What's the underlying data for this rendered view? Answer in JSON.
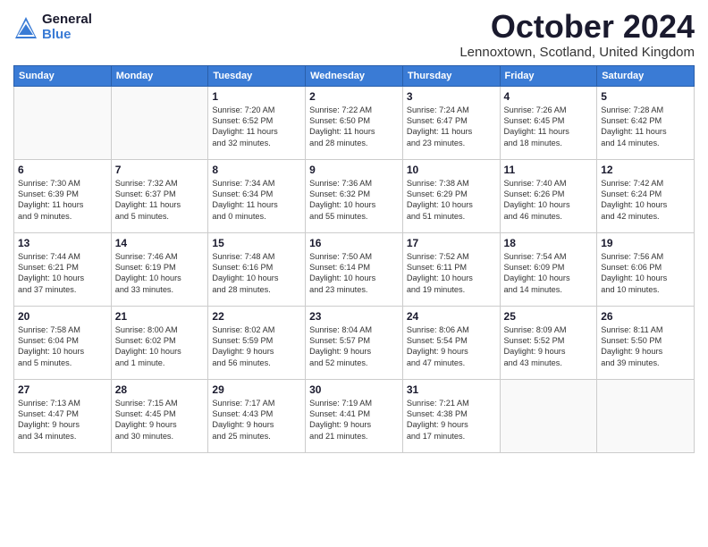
{
  "header": {
    "logo_general": "General",
    "logo_blue": "Blue",
    "month": "October 2024",
    "location": "Lennoxtown, Scotland, United Kingdom"
  },
  "days_of_week": [
    "Sunday",
    "Monday",
    "Tuesday",
    "Wednesday",
    "Thursday",
    "Friday",
    "Saturday"
  ],
  "weeks": [
    [
      {
        "day": "",
        "detail": ""
      },
      {
        "day": "",
        "detail": ""
      },
      {
        "day": "1",
        "detail": "Sunrise: 7:20 AM\nSunset: 6:52 PM\nDaylight: 11 hours\nand 32 minutes."
      },
      {
        "day": "2",
        "detail": "Sunrise: 7:22 AM\nSunset: 6:50 PM\nDaylight: 11 hours\nand 28 minutes."
      },
      {
        "day": "3",
        "detail": "Sunrise: 7:24 AM\nSunset: 6:47 PM\nDaylight: 11 hours\nand 23 minutes."
      },
      {
        "day": "4",
        "detail": "Sunrise: 7:26 AM\nSunset: 6:45 PM\nDaylight: 11 hours\nand 18 minutes."
      },
      {
        "day": "5",
        "detail": "Sunrise: 7:28 AM\nSunset: 6:42 PM\nDaylight: 11 hours\nand 14 minutes."
      }
    ],
    [
      {
        "day": "6",
        "detail": "Sunrise: 7:30 AM\nSunset: 6:39 PM\nDaylight: 11 hours\nand 9 minutes."
      },
      {
        "day": "7",
        "detail": "Sunrise: 7:32 AM\nSunset: 6:37 PM\nDaylight: 11 hours\nand 5 minutes."
      },
      {
        "day": "8",
        "detail": "Sunrise: 7:34 AM\nSunset: 6:34 PM\nDaylight: 11 hours\nand 0 minutes."
      },
      {
        "day": "9",
        "detail": "Sunrise: 7:36 AM\nSunset: 6:32 PM\nDaylight: 10 hours\nand 55 minutes."
      },
      {
        "day": "10",
        "detail": "Sunrise: 7:38 AM\nSunset: 6:29 PM\nDaylight: 10 hours\nand 51 minutes."
      },
      {
        "day": "11",
        "detail": "Sunrise: 7:40 AM\nSunset: 6:26 PM\nDaylight: 10 hours\nand 46 minutes."
      },
      {
        "day": "12",
        "detail": "Sunrise: 7:42 AM\nSunset: 6:24 PM\nDaylight: 10 hours\nand 42 minutes."
      }
    ],
    [
      {
        "day": "13",
        "detail": "Sunrise: 7:44 AM\nSunset: 6:21 PM\nDaylight: 10 hours\nand 37 minutes."
      },
      {
        "day": "14",
        "detail": "Sunrise: 7:46 AM\nSunset: 6:19 PM\nDaylight: 10 hours\nand 33 minutes."
      },
      {
        "day": "15",
        "detail": "Sunrise: 7:48 AM\nSunset: 6:16 PM\nDaylight: 10 hours\nand 28 minutes."
      },
      {
        "day": "16",
        "detail": "Sunrise: 7:50 AM\nSunset: 6:14 PM\nDaylight: 10 hours\nand 23 minutes."
      },
      {
        "day": "17",
        "detail": "Sunrise: 7:52 AM\nSunset: 6:11 PM\nDaylight: 10 hours\nand 19 minutes."
      },
      {
        "day": "18",
        "detail": "Sunrise: 7:54 AM\nSunset: 6:09 PM\nDaylight: 10 hours\nand 14 minutes."
      },
      {
        "day": "19",
        "detail": "Sunrise: 7:56 AM\nSunset: 6:06 PM\nDaylight: 10 hours\nand 10 minutes."
      }
    ],
    [
      {
        "day": "20",
        "detail": "Sunrise: 7:58 AM\nSunset: 6:04 PM\nDaylight: 10 hours\nand 5 minutes."
      },
      {
        "day": "21",
        "detail": "Sunrise: 8:00 AM\nSunset: 6:02 PM\nDaylight: 10 hours\nand 1 minute."
      },
      {
        "day": "22",
        "detail": "Sunrise: 8:02 AM\nSunset: 5:59 PM\nDaylight: 9 hours\nand 56 minutes."
      },
      {
        "day": "23",
        "detail": "Sunrise: 8:04 AM\nSunset: 5:57 PM\nDaylight: 9 hours\nand 52 minutes."
      },
      {
        "day": "24",
        "detail": "Sunrise: 8:06 AM\nSunset: 5:54 PM\nDaylight: 9 hours\nand 47 minutes."
      },
      {
        "day": "25",
        "detail": "Sunrise: 8:09 AM\nSunset: 5:52 PM\nDaylight: 9 hours\nand 43 minutes."
      },
      {
        "day": "26",
        "detail": "Sunrise: 8:11 AM\nSunset: 5:50 PM\nDaylight: 9 hours\nand 39 minutes."
      }
    ],
    [
      {
        "day": "27",
        "detail": "Sunrise: 7:13 AM\nSunset: 4:47 PM\nDaylight: 9 hours\nand 34 minutes."
      },
      {
        "day": "28",
        "detail": "Sunrise: 7:15 AM\nSunset: 4:45 PM\nDaylight: 9 hours\nand 30 minutes."
      },
      {
        "day": "29",
        "detail": "Sunrise: 7:17 AM\nSunset: 4:43 PM\nDaylight: 9 hours\nand 25 minutes."
      },
      {
        "day": "30",
        "detail": "Sunrise: 7:19 AM\nSunset: 4:41 PM\nDaylight: 9 hours\nand 21 minutes."
      },
      {
        "day": "31",
        "detail": "Sunrise: 7:21 AM\nSunset: 4:38 PM\nDaylight: 9 hours\nand 17 minutes."
      },
      {
        "day": "",
        "detail": ""
      },
      {
        "day": "",
        "detail": ""
      }
    ]
  ]
}
